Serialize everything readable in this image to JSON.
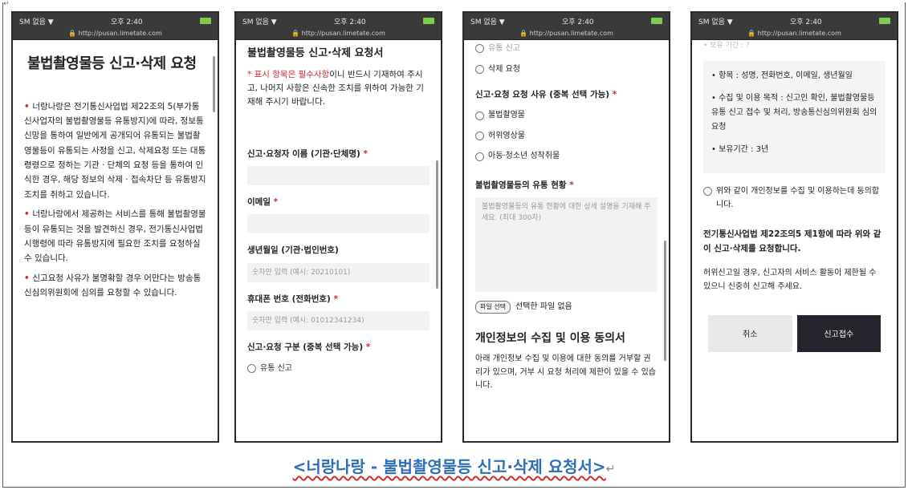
{
  "top_mark": "↵",
  "status": {
    "carrier": "SM 없음 ▼",
    "time": "오후 2:40",
    "url": "🔒 http://pusan.limetate.com"
  },
  "screen1": {
    "title": "불법촬영물등 신고·삭제 요청",
    "bullets": [
      "너랑나랑은 전기통신사업법 제22조의 5(부가통신사업자의 불법촬영물등 유통방지)에 따라, 정보통신망을 통하여 일반에게 공개되어 유통되는 불법촬영물등이 유통되는 사정을 신고, 삭제요청 또는 대통령령으로 정하는 기관 · 단체의 요청 등을 통하여 인식한 경우, 해당 정보의 삭제 · 접속차단 등 유통방지 조치를 취하고 있습니다.",
      "너랑나랑에서 제공하는 서비스를 통해 불법촬영물등이 유통되는 것을 발견하신 경우, 전기통신사업법 시행령에 따라 유통방지에 필요한 조치를 요청하실 수 있습니다.",
      "신고요청 사유가 불명확할 경우 어만다는 방송통신심의위원회에 심의를 요청할 수 있습니다."
    ]
  },
  "screen2": {
    "heading": "불법촬영물등 신고·삭제 요청서",
    "note_red": "* 표시 항목은 필수사항",
    "note_rest": "이니 반드시 기재하여 주시고, 나머지 사항은 신속한 조치를 위하여 가능한 기재해 주시기 바랍니다.",
    "fields": [
      {
        "label": "신고·요청자 이름 (기관·단체명)",
        "required": true,
        "placeholder": ""
      },
      {
        "label": "이메일",
        "required": true,
        "placeholder": ""
      },
      {
        "label": "생년월일 (기관·법인번호)",
        "required": false,
        "placeholder": "숫자만 입력 (예시: 20210101)"
      },
      {
        "label": "휴대폰 번호 (전화번호)",
        "required": true,
        "placeholder": "숫자만 입력 (예시: 01012341234)"
      }
    ],
    "type_label": "신고·요청 구분 (중복 선택 가능)",
    "type_option": "유통 신고"
  },
  "screen3": {
    "option_top": "유통 신고",
    "option_delete": "삭제 요청",
    "reason_label": "신고·요청 요청 사유 (중복 선택 가능)",
    "reasons": [
      "불법촬영물",
      "허위영상물",
      "아동·청소년 성착취물"
    ],
    "status_label": "불법촬영물등의 유통 현황",
    "textarea_placeholder": "불법촬영물등의 유통 현황에 대한 상세 설명을 기재해 주세요. (최대 300자)",
    "file_button": "파일 선택",
    "file_status": "선택한 파일 없음",
    "consent_heading": "개인정보의 수집 및 이용 동의서",
    "consent_text": "아래 개인정보 수집 및 이용에 대한 동의를 거부할 권리가 있으며, 거부 시 요청 처리에 제한이 있을 수 있습니다."
  },
  "screen4": {
    "top_fragment": "• 보유 기간 : ?",
    "items": [
      "• 항목 : 성명, 전화번호, 이메일, 생년월일",
      "• 수집 및 이용 목적 : 신고인 확인, 불법촬영물등 유통 신고 접수 및 처리, 방송통신심의위원회 심의 요청",
      "• 보유기간 : 3년"
    ],
    "agree_text": "위와 같이 개인정보를 수집 및 이용하는데 동의합니다.",
    "law_text": "전기통신사업법 제22조의5 제1항에 따라 위와 같이 신고·삭제를 요청합니다.",
    "warning_text": "허위신고일 경우, 신고자의 서비스 활동이 제한될 수 있으니 신중히 신고해 주세요.",
    "cancel": "취소",
    "submit": "신고접수"
  },
  "caption": {
    "text": "<너랑나랑 - 불법촬영물등 신고·삭제 요청서>",
    "mark": "↵"
  },
  "colors": {
    "required": "#d42a2a",
    "caption": "#2d6eb8",
    "submit_bg": "#25252e",
    "battery": "#7ccd4f"
  }
}
